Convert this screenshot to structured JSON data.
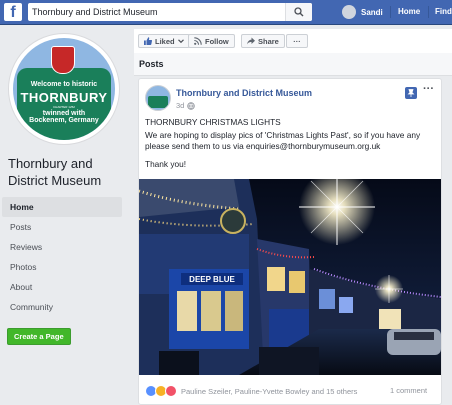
{
  "topbar": {
    "logo": "f",
    "search_value": "Thornbury and District Museum",
    "user_name": "Sandi",
    "nav": [
      "Home",
      "Find"
    ],
    "color": "#4267b2",
    "search_icon": "magnifier-icon"
  },
  "profile": {
    "sign_lines": {
      "welcome": "Welcome to historic",
      "town": "THORNBURY",
      "charter": "CHARTER 1252",
      "twinned_1": "twinned with",
      "twinned_2": "Bockenem, Germany"
    },
    "page_name": "Thornbury and District Museum"
  },
  "sidebar": {
    "items": [
      {
        "label": "Home",
        "active": true
      },
      {
        "label": "Posts",
        "active": false
      },
      {
        "label": "Reviews",
        "active": false
      },
      {
        "label": "Photos",
        "active": false
      },
      {
        "label": "About",
        "active": false
      },
      {
        "label": "Community",
        "active": false
      }
    ],
    "create_page": "Create a Page"
  },
  "actions": {
    "liked": "Liked",
    "follow": "Follow",
    "share": "Share",
    "more": "···"
  },
  "posts_section": {
    "title": "Posts"
  },
  "post": {
    "author": "Thornbury and District Museum",
    "time": "3d",
    "more": "···",
    "headline": "THORNBURY CHRISTMAS LIGHTS",
    "body": "We are hoping to display pics of 'Christmas Lights Past', so if you have any please send them to us via enquiries@thornburymuseum.org.uk",
    "closing": "Thank you!",
    "shop_sign": "DEEP BLUE",
    "reactors": "Pauline Szeiler, Pauline-Yvette Bowley and 15 others",
    "comments": "1 comment",
    "reaction_colors": [
      "#5890ff",
      "#f7b125",
      "#f25268"
    ]
  }
}
